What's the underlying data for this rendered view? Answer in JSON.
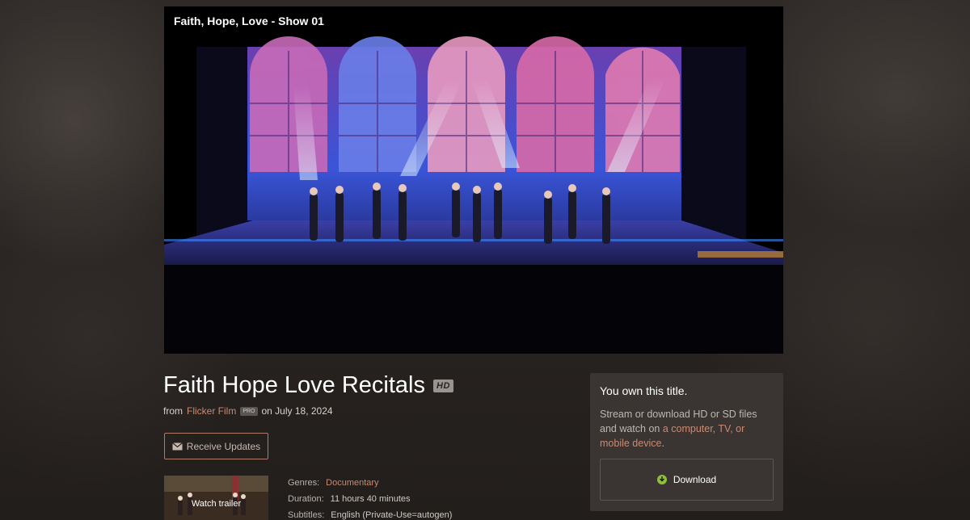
{
  "player": {
    "title": "Faith, Hope, Love - Show 01"
  },
  "film": {
    "title": "Faith Hope Love Recitals",
    "quality_badge": "HD",
    "from_label": "from",
    "creator": "Flicker Film",
    "creator_badge": "PRO",
    "date_text": "on July 18, 2024"
  },
  "actions": {
    "receive_updates": "Receive Updates",
    "watch_trailer": "Watch trailer"
  },
  "meta": {
    "genres_label": "Genres:",
    "genres_value": "Documentary",
    "duration_label": "Duration:",
    "duration_value": "11 hours 40 minutes",
    "subtitles_label": "Subtitles:",
    "subtitles_value": "English (Private-Use=autogen)"
  },
  "ownership": {
    "heading": "You own this title.",
    "desc_part1": "Stream or download HD or SD files and watch on ",
    "desc_link": "a computer, TV, or mobile device",
    "desc_end": ".",
    "download_label": "Download"
  },
  "colors": {
    "accent_link": "#c98a72",
    "download_icon": "#8fbf3a"
  }
}
